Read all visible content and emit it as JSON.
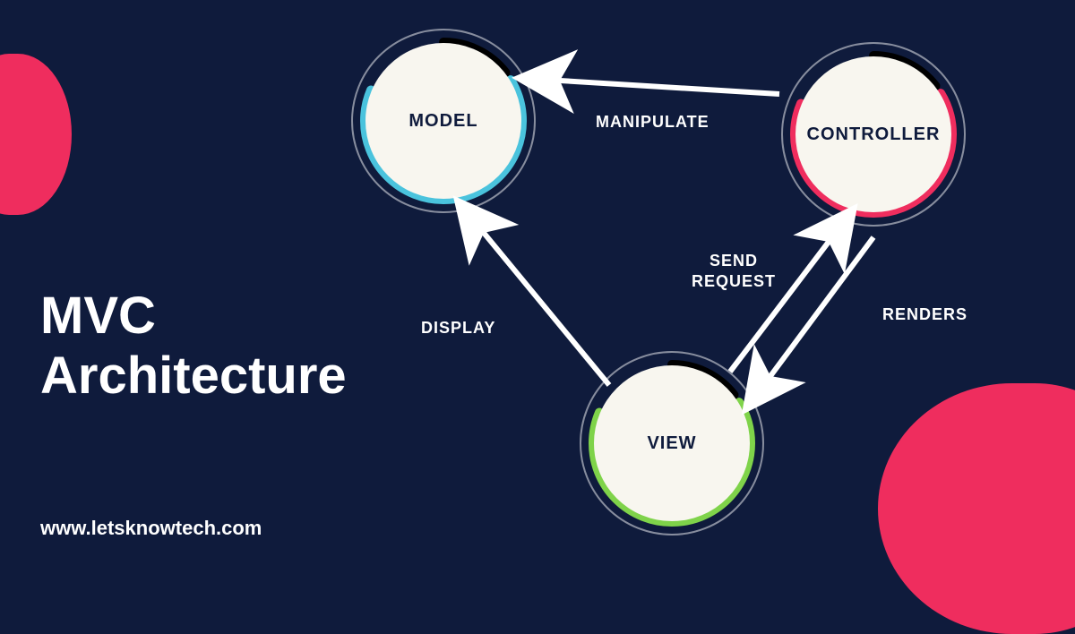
{
  "title_line1": "MVC",
  "title_line2": "Architecture",
  "footer": "www.letsknowtech.com",
  "nodes": {
    "model": {
      "label": "MODEL",
      "accent": "#4ac3dd"
    },
    "controller": {
      "label": "CONTROLLER",
      "accent": "#ef2d5e"
    },
    "view": {
      "label": "VIEW",
      "accent": "#7fd34a"
    }
  },
  "edges": {
    "manipulate": "MANIPULATE",
    "send_request_l1": "SEND",
    "send_request_l2": "REQUEST",
    "renders": "RENDERS",
    "display": "DISPLAY"
  },
  "colors": {
    "bg": "#0f1b3c",
    "accent_pink": "#ef2d5e",
    "white": "#ffffff"
  }
}
